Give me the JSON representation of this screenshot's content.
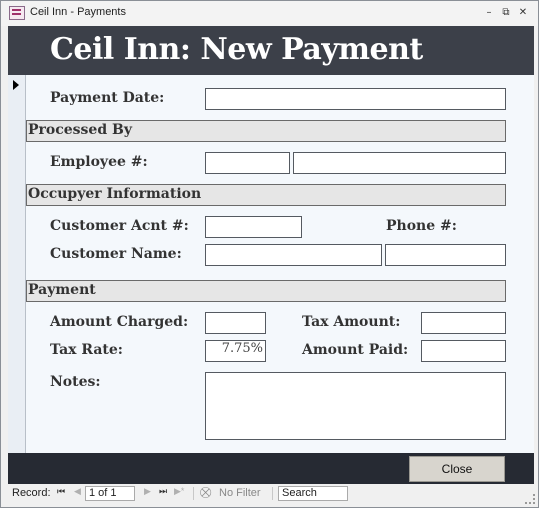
{
  "window": {
    "title": "Ceil Inn - Payments",
    "minimize": "–",
    "restore": "⧉",
    "close": "✕"
  },
  "form": {
    "title": "Ceil Inn: New Payment"
  },
  "fields": {
    "payment_date": {
      "label": "Payment Date:",
      "value": ""
    },
    "employee": {
      "label": "Employee #:",
      "value": "",
      "name_value": ""
    },
    "customer_acnt": {
      "label": "Customer Acnt #:",
      "value": ""
    },
    "phone": {
      "label": "Phone #:"
    },
    "customer_name": {
      "label": "Customer Name:",
      "first": "",
      "last": ""
    },
    "amount_charged": {
      "label": "Amount Charged:",
      "value": ""
    },
    "tax_amount": {
      "label": "Tax Amount:",
      "value": ""
    },
    "tax_rate": {
      "label": "Tax Rate:",
      "value": "7.75%"
    },
    "amount_paid": {
      "label": "Amount Paid:",
      "value": ""
    },
    "notes": {
      "label": "Notes:",
      "value": ""
    }
  },
  "sections": {
    "processed_by": "Processed By",
    "occupyer": "Occupyer Information",
    "payment": "Payment"
  },
  "footer": {
    "close_label": "Close"
  },
  "navbar": {
    "record_label": "Record:",
    "record_value": "1 of 1",
    "filter_label": "No Filter",
    "search_label": "Search",
    "first": "⏮",
    "prev": "◀",
    "next": "▶",
    "last": "⏭",
    "new": "▶*"
  }
}
